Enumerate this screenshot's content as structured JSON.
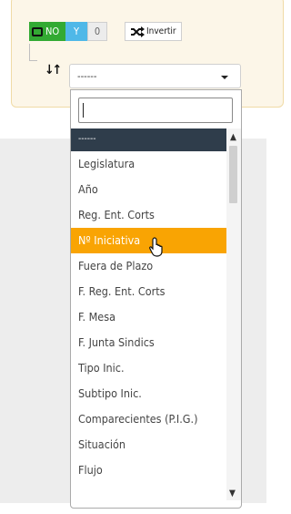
{
  "filter": {
    "toggle": {
      "no_label": "NO",
      "yes_label": "Y",
      "zero_label": "0"
    },
    "invert_label": "Invertir",
    "sort_icon": "sort-arrows-icon",
    "select_value": "------"
  },
  "dropdown": {
    "search_value": "",
    "options": [
      "------",
      "Legislatura",
      "Año",
      "Reg. Ent. Corts",
      "Nº Iniciativa",
      "Fuera de Plazo",
      "F. Reg. Ent. Corts",
      "F. Mesa",
      "F. Junta Sindics",
      "Tipo Inic.",
      "Subtipo Inic.",
      "Comparecientes (P.I.G.)",
      "Situación",
      "Flujo"
    ],
    "selected_index": 0,
    "highlighted_index": 4
  },
  "colors": {
    "toggle_no": "#33aa33",
    "toggle_yes": "#4fb8e8",
    "selected_option": "#2f3d4b",
    "highlighted_option": "#f9a403",
    "panel_bg": "#fcf6e8"
  }
}
